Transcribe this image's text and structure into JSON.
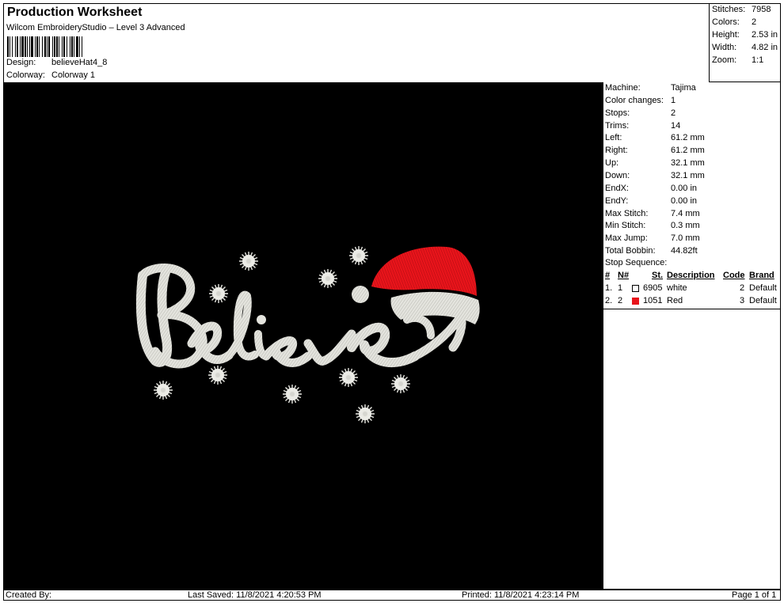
{
  "header": {
    "title": "Production Worksheet",
    "software": "Wilcom EmbroideryStudio – Level 3 Advanced",
    "design_label": "Design:",
    "design_value": "believeHat4_8",
    "colorway_label": "Colorway:",
    "colorway_value": "Colorway 1"
  },
  "stats": [
    {
      "label": "Stitches:",
      "value": "7958"
    },
    {
      "label": "Colors:",
      "value": "2"
    },
    {
      "label": "Height:",
      "value": "2.53 in"
    },
    {
      "label": "Width:",
      "value": "4.82 in"
    },
    {
      "label": "Zoom:",
      "value": "1:1"
    }
  ],
  "machine_info": [
    {
      "label": "Machine:",
      "value": "Tajima"
    },
    {
      "label": "Color changes:",
      "value": "1"
    },
    {
      "label": "Stops:",
      "value": "2"
    },
    {
      "label": "Trims:",
      "value": "14"
    },
    {
      "label": "Left:",
      "value": "61.2 mm"
    },
    {
      "label": "Right:",
      "value": "61.2 mm"
    },
    {
      "label": "Up:",
      "value": "32.1 mm"
    },
    {
      "label": "Down:",
      "value": "32.1 mm"
    },
    {
      "label": "EndX:",
      "value": "0.00 in"
    },
    {
      "label": "EndY:",
      "value": "0.00 in"
    },
    {
      "label": "Max Stitch:",
      "value": "7.4 mm"
    },
    {
      "label": "Min Stitch:",
      "value": "0.3 mm"
    },
    {
      "label": "Max Jump:",
      "value": "7.0 mm"
    },
    {
      "label": "Total Bobbin:",
      "value": "44.82ft"
    }
  ],
  "stop_sequence": {
    "title": "Stop Sequence:",
    "columns": [
      "#",
      "N#",
      "St.",
      "Description",
      "Code",
      "Brand"
    ],
    "rows": [
      {
        "num": "1.",
        "n": "1",
        "swatch_color": "#ffffff",
        "stitch": "6905",
        "description": "white",
        "code": "2",
        "brand": "Default"
      },
      {
        "num": "2.",
        "n": "2",
        "swatch_color": "#e8141b",
        "stitch": "1051",
        "description": "Red",
        "code": "3",
        "brand": "Default"
      }
    ]
  },
  "design_preview": {
    "text": "Believe",
    "thread_colors": [
      "#e6e6e0",
      "#e8141b"
    ],
    "background": "#000000"
  },
  "footer": {
    "created_by": "Created By:",
    "last_saved": "Last Saved: 11/8/2021 4:20:53 PM",
    "printed": "Printed: 11/8/2021 4:23:14 PM",
    "page": "Page 1 of 1"
  }
}
